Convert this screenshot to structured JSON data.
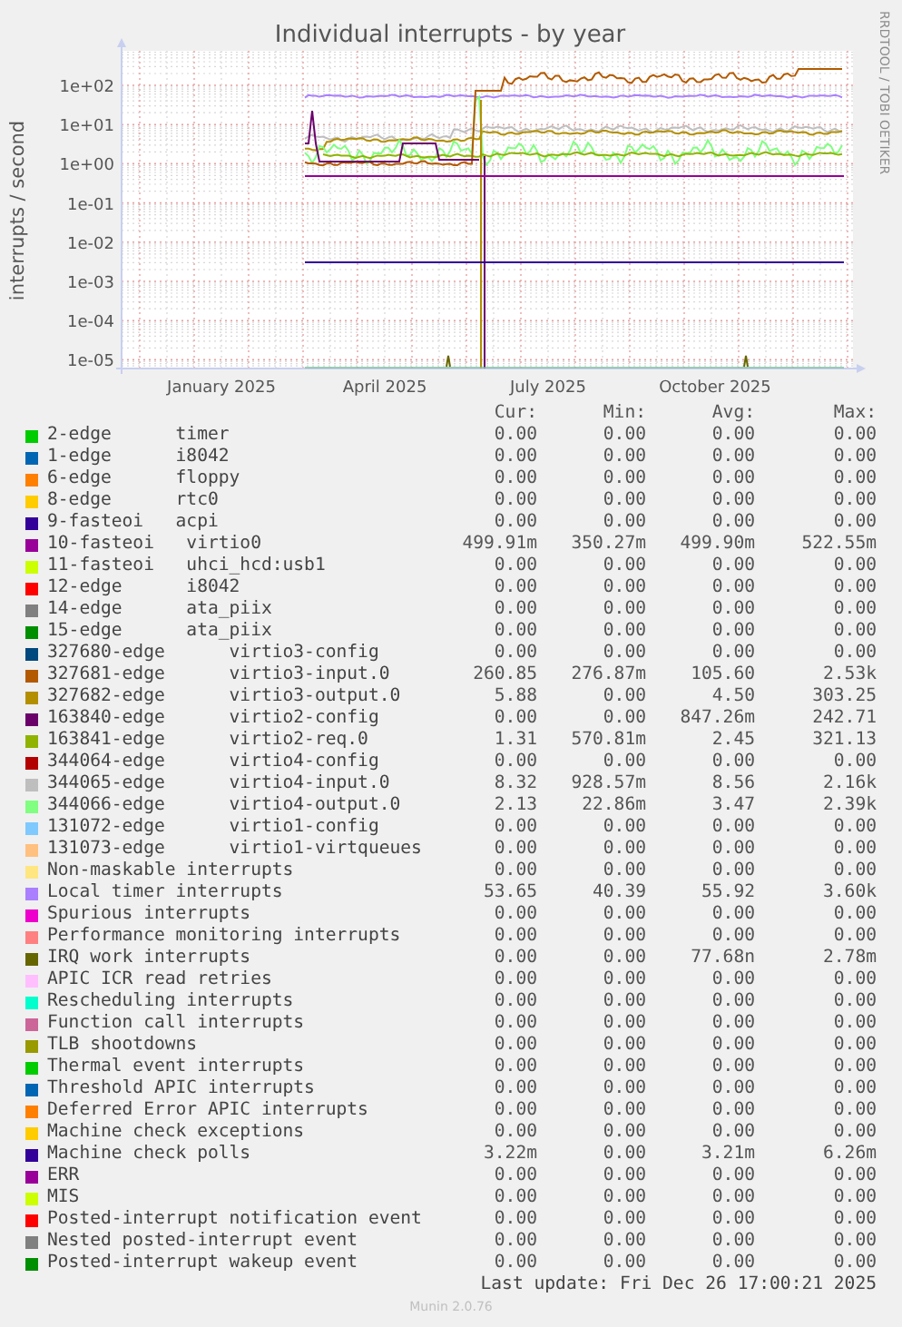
{
  "chart": {
    "title": "Individual interrupts - by year",
    "ylabel": "interrupts / second",
    "credit": "RRDTOOL / TOBI OETIKER",
    "yticks": [
      "1e+02",
      "1e+01",
      "1e+00",
      "1e-01",
      "1e-02",
      "1e-03",
      "1e-04",
      "1e-05"
    ],
    "xticks": [
      "January 2025",
      "April 2025",
      "July 2025",
      "October 2025"
    ]
  },
  "legend": {
    "columns": [
      "Cur:",
      "Min:",
      "Avg:",
      "Max:"
    ],
    "rows": [
      {
        "label": "2-edge      timer",
        "color": "#00cc00",
        "cur": "0.00",
        "min": "0.00",
        "avg": "0.00",
        "max": "0.00"
      },
      {
        "label": "1-edge      i8042",
        "color": "#0066b3",
        "cur": "0.00",
        "min": "0.00",
        "avg": "0.00",
        "max": "0.00"
      },
      {
        "label": "6-edge      floppy",
        "color": "#ff8000",
        "cur": "0.00",
        "min": "0.00",
        "avg": "0.00",
        "max": "0.00"
      },
      {
        "label": "8-edge      rtc0",
        "color": "#ffcc00",
        "cur": "0.00",
        "min": "0.00",
        "avg": "0.00",
        "max": "0.00"
      },
      {
        "label": "9-fasteoi   acpi",
        "color": "#330099",
        "cur": "0.00",
        "min": "0.00",
        "avg": "0.00",
        "max": "0.00"
      },
      {
        "label": "10-fasteoi   virtio0",
        "color": "#990099",
        "cur": "499.91m",
        "min": "350.27m",
        "avg": "499.90m",
        "max": "522.55m"
      },
      {
        "label": "11-fasteoi   uhci_hcd:usb1",
        "color": "#ccff00",
        "cur": "0.00",
        "min": "0.00",
        "avg": "0.00",
        "max": "0.00"
      },
      {
        "label": "12-edge      i8042",
        "color": "#ff0000",
        "cur": "0.00",
        "min": "0.00",
        "avg": "0.00",
        "max": "0.00"
      },
      {
        "label": "14-edge      ata_piix",
        "color": "#808080",
        "cur": "0.00",
        "min": "0.00",
        "avg": "0.00",
        "max": "0.00"
      },
      {
        "label": "15-edge      ata_piix",
        "color": "#008f00",
        "cur": "0.00",
        "min": "0.00",
        "avg": "0.00",
        "max": "0.00"
      },
      {
        "label": "327680-edge      virtio3-config",
        "color": "#00487d",
        "cur": "0.00",
        "min": "0.00",
        "avg": "0.00",
        "max": "0.00"
      },
      {
        "label": "327681-edge      virtio3-input.0",
        "color": "#b35a00",
        "cur": "260.85",
        "min": "276.87m",
        "avg": "105.60",
        "max": "2.53k"
      },
      {
        "label": "327682-edge      virtio3-output.0",
        "color": "#b38f00",
        "cur": "5.88",
        "min": "0.00",
        "avg": "4.50",
        "max": "303.25"
      },
      {
        "label": "163840-edge      virtio2-config",
        "color": "#6b006b",
        "cur": "0.00",
        "min": "0.00",
        "avg": "847.26m",
        "max": "242.71"
      },
      {
        "label": "163841-edge      virtio2-req.0",
        "color": "#8fb300",
        "cur": "1.31",
        "min": "570.81m",
        "avg": "2.45",
        "max": "321.13"
      },
      {
        "label": "344064-edge      virtio4-config",
        "color": "#b30000",
        "cur": "0.00",
        "min": "0.00",
        "avg": "0.00",
        "max": "0.00"
      },
      {
        "label": "344065-edge      virtio4-input.0",
        "color": "#bebebe",
        "cur": "8.32",
        "min": "928.57m",
        "avg": "8.56",
        "max": "2.16k"
      },
      {
        "label": "344066-edge      virtio4-output.0",
        "color": "#80ff80",
        "cur": "2.13",
        "min": "22.86m",
        "avg": "3.47",
        "max": "2.39k"
      },
      {
        "label": "131072-edge      virtio1-config",
        "color": "#80c9ff",
        "cur": "0.00",
        "min": "0.00",
        "avg": "0.00",
        "max": "0.00"
      },
      {
        "label": "131073-edge      virtio1-virtqueues",
        "color": "#ffc080",
        "cur": "0.00",
        "min": "0.00",
        "avg": "0.00",
        "max": "0.00"
      },
      {
        "label": "Non-maskable interrupts",
        "color": "#ffe680",
        "cur": "0.00",
        "min": "0.00",
        "avg": "0.00",
        "max": "0.00"
      },
      {
        "label": "Local timer interrupts",
        "color": "#aa80ff",
        "cur": "53.65",
        "min": "40.39",
        "avg": "55.92",
        "max": "3.60k"
      },
      {
        "label": "Spurious interrupts",
        "color": "#ee00cc",
        "cur": "0.00",
        "min": "0.00",
        "avg": "0.00",
        "max": "0.00"
      },
      {
        "label": "Performance monitoring interrupts",
        "color": "#ff8080",
        "cur": "0.00",
        "min": "0.00",
        "avg": "0.00",
        "max": "0.00"
      },
      {
        "label": "IRQ work interrupts",
        "color": "#666600",
        "cur": "0.00",
        "min": "0.00",
        "avg": "77.68n",
        "max": "2.78m"
      },
      {
        "label": "APIC ICR read retries",
        "color": "#ffbfff",
        "cur": "0.00",
        "min": "0.00",
        "avg": "0.00",
        "max": "0.00"
      },
      {
        "label": "Rescheduling interrupts",
        "color": "#00ffcc",
        "cur": "0.00",
        "min": "0.00",
        "avg": "0.00",
        "max": "0.00"
      },
      {
        "label": "Function call interrupts",
        "color": "#cc6699",
        "cur": "0.00",
        "min": "0.00",
        "avg": "0.00",
        "max": "0.00"
      },
      {
        "label": "TLB shootdowns",
        "color": "#999900",
        "cur": "0.00",
        "min": "0.00",
        "avg": "0.00",
        "max": "0.00"
      },
      {
        "label": "Thermal event interrupts",
        "color": "#00cc00",
        "cur": "0.00",
        "min": "0.00",
        "avg": "0.00",
        "max": "0.00"
      },
      {
        "label": "Threshold APIC interrupts",
        "color": "#0066b3",
        "cur": "0.00",
        "min": "0.00",
        "avg": "0.00",
        "max": "0.00"
      },
      {
        "label": "Deferred Error APIC interrupts",
        "color": "#ff8000",
        "cur": "0.00",
        "min": "0.00",
        "avg": "0.00",
        "max": "0.00"
      },
      {
        "label": "Machine check exceptions",
        "color": "#ffcc00",
        "cur": "0.00",
        "min": "0.00",
        "avg": "0.00",
        "max": "0.00"
      },
      {
        "label": "Machine check polls",
        "color": "#330099",
        "cur": "3.22m",
        "min": "0.00",
        "avg": "3.21m",
        "max": "6.26m"
      },
      {
        "label": "ERR",
        "color": "#990099",
        "cur": "0.00",
        "min": "0.00",
        "avg": "0.00",
        "max": "0.00"
      },
      {
        "label": "MIS",
        "color": "#ccff00",
        "cur": "0.00",
        "min": "0.00",
        "avg": "0.00",
        "max": "0.00"
      },
      {
        "label": "Posted-interrupt notification event",
        "color": "#ff0000",
        "cur": "0.00",
        "min": "0.00",
        "avg": "0.00",
        "max": "0.00"
      },
      {
        "label": "Nested posted-interrupt event",
        "color": "#808080",
        "cur": "0.00",
        "min": "0.00",
        "avg": "0.00",
        "max": "0.00"
      },
      {
        "label": "Posted-interrupt wakeup event",
        "color": "#008f00",
        "cur": "0.00",
        "min": "0.00",
        "avg": "0.00",
        "max": "0.00"
      }
    ]
  },
  "last_update": "Last update: Fri Dec 26 17:00:21 2025",
  "footer": "Munin 2.0.76"
}
